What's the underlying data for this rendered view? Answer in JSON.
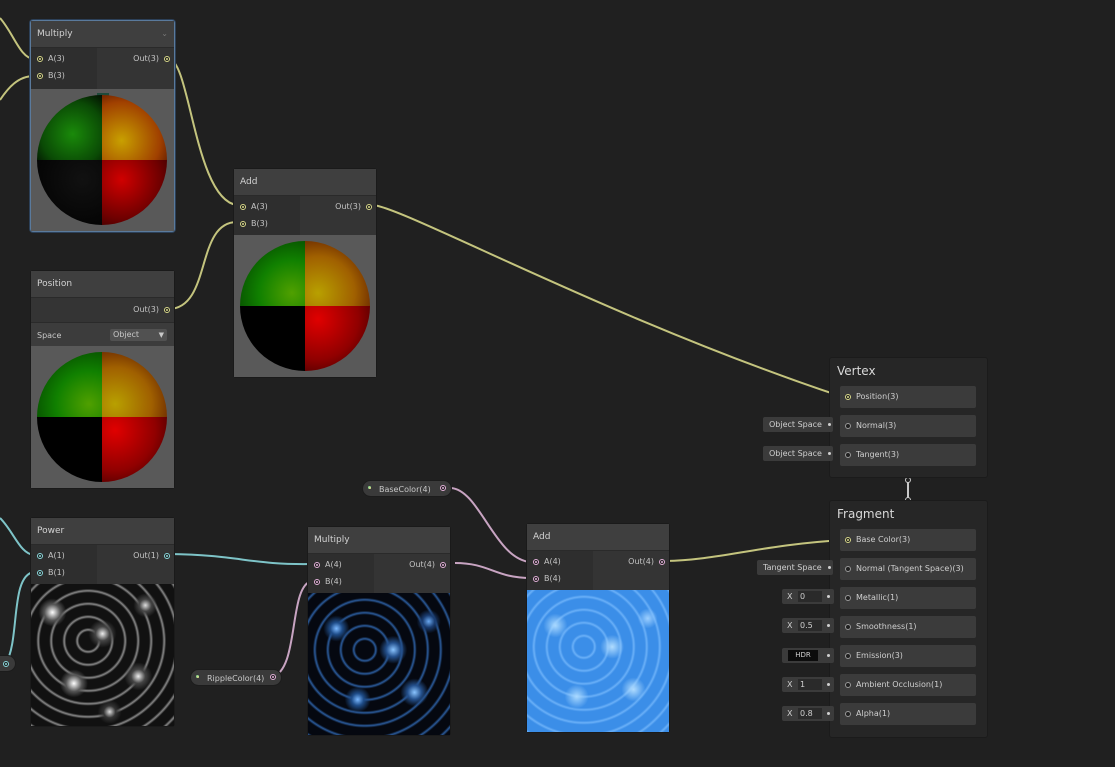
{
  "nodes": {
    "multiply_top": {
      "title": "Multiply",
      "in_a": "A(3)",
      "in_b": "B(3)",
      "out": "Out(3)"
    },
    "add_top": {
      "title": "Add",
      "in_a": "A(3)",
      "in_b": "B(3)",
      "out": "Out(3)"
    },
    "position": {
      "title": "Position",
      "out": "Out(3)",
      "space_label": "Space",
      "space_value": "Object"
    },
    "power": {
      "title": "Power",
      "in_a": "A(1)",
      "in_b": "B(1)",
      "out": "Out(1)"
    },
    "multiply_bottom": {
      "title": "Multiply",
      "in_a": "A(4)",
      "in_b": "B(4)",
      "out": "Out(4)"
    },
    "add_bottom": {
      "title": "Add",
      "in_a": "A(4)",
      "in_b": "B(4)",
      "out": "Out(4)"
    }
  },
  "properties": {
    "base_color": "BaseColor(4)",
    "ripple_color": "RippleColor(4)"
  },
  "vertex": {
    "title": "Vertex",
    "slots": [
      "Position(3)",
      "Normal(3)",
      "Tangent(3)"
    ],
    "normal_default": "Object Space",
    "tangent_default": "Object Space"
  },
  "fragment": {
    "title": "Fragment",
    "slots": [
      "Base Color(3)",
      "Normal (Tangent Space)(3)",
      "Metallic(1)",
      "Smoothness(1)",
      "Emission(3)",
      "Ambient Occlusion(1)",
      "Alpha(1)"
    ],
    "normal_default": "Tangent Space",
    "x_label": "X",
    "metallic_value": "0",
    "smoothness_value": "0.5",
    "emission_label": "HDR",
    "ao_value": "1",
    "alpha_value": "0.8"
  },
  "colors": {
    "vector3_wire": "#c4c47e",
    "vector1_wire": "#7ec4c8",
    "vector4_wire": "#c8a4c2",
    "selection": "#5a7a9c"
  }
}
